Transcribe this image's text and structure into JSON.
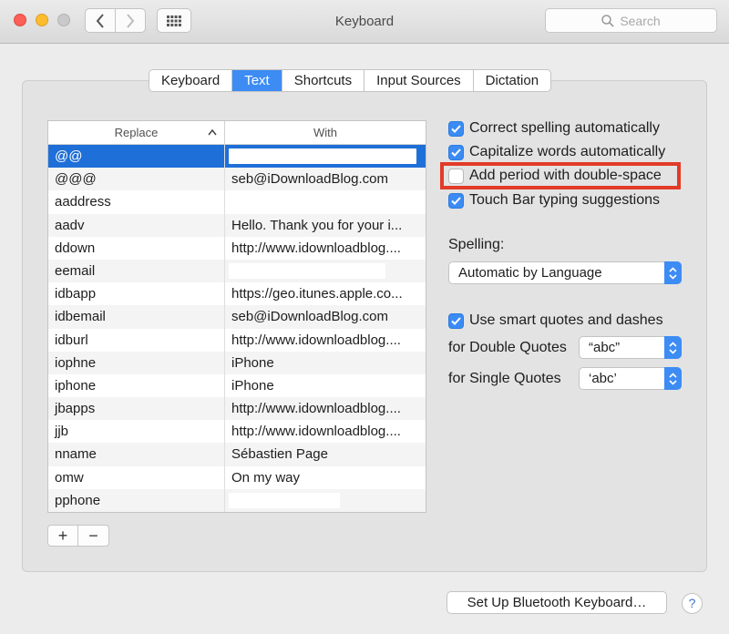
{
  "window": {
    "title": "Keyboard"
  },
  "search": {
    "placeholder": "Search"
  },
  "tabs": [
    "Keyboard",
    "Text",
    "Shortcuts",
    "Input Sources",
    "Dictation"
  ],
  "table": {
    "col_replace": "Replace",
    "col_with": "With",
    "rows": [
      {
        "replace": "@@",
        "with": ""
      },
      {
        "replace": "@@@",
        "with": "seb@iDownloadBlog.com"
      },
      {
        "replace": "aaddress",
        "with": ""
      },
      {
        "replace": "aadv",
        "with": "Hello. Thank you for your i..."
      },
      {
        "replace": "ddown",
        "with": "http://www.idownloadblog...."
      },
      {
        "replace": "eemail",
        "with": ""
      },
      {
        "replace": "idbapp",
        "with": "https://geo.itunes.apple.co..."
      },
      {
        "replace": "idbemail",
        "with": "seb@iDownloadBlog.com"
      },
      {
        "replace": "idburl",
        "with": "http://www.idownloadblog...."
      },
      {
        "replace": "iophne",
        "with": "iPhone"
      },
      {
        "replace": "iphone",
        "with": "iPhone"
      },
      {
        "replace": "jbapps",
        "with": "http://www.idownloadblog...."
      },
      {
        "replace": "jjb",
        "with": "http://www.idownloadblog...."
      },
      {
        "replace": "nname",
        "with": "Sébastien Page"
      },
      {
        "replace": "omw",
        "with": "On my way"
      },
      {
        "replace": "pphone",
        "with": ""
      }
    ]
  },
  "buttons": {
    "add": "+",
    "remove": "−",
    "bluetooth": "Set Up Bluetooth Keyboard…",
    "help": "?"
  },
  "options": {
    "correct_spelling": "Correct spelling automatically",
    "capitalize": "Capitalize words automatically",
    "double_space": "Add period with double-space",
    "touch_bar": "Touch Bar typing suggestions",
    "spelling_label": "Spelling:",
    "spelling_value": "Automatic by Language",
    "smart_quotes": "Use smart quotes and dashes",
    "double_quotes_label": "for Double Quotes",
    "double_quotes_value": "“abc”",
    "single_quotes_label": "for Single Quotes",
    "single_quotes_value": "‘abc’"
  },
  "colors": {
    "accent": "#3d8cf4",
    "selection": "#1f6fd8",
    "highlight": "#e23b28"
  }
}
